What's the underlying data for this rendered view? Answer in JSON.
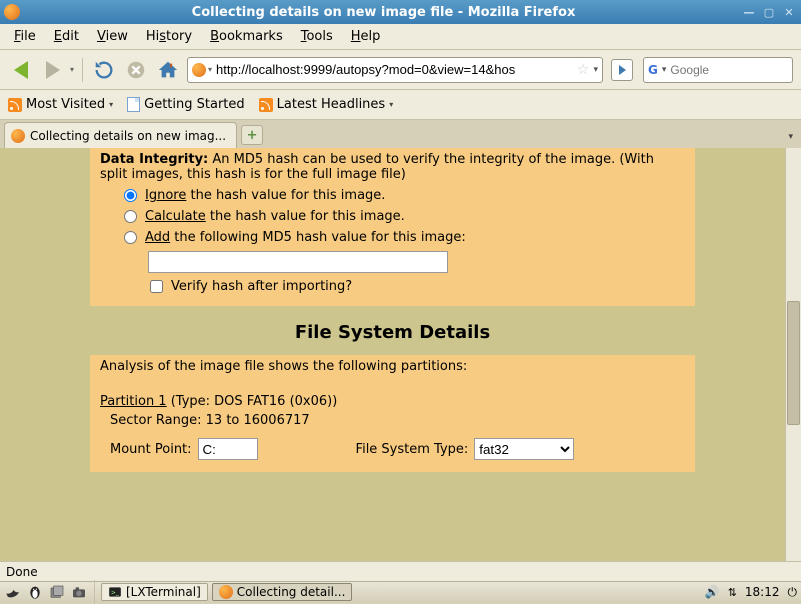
{
  "window": {
    "title": "Collecting details on new image file - Mozilla Firefox"
  },
  "menubar": {
    "file": "File",
    "edit": "Edit",
    "view": "View",
    "history": "History",
    "bookmarks": "Bookmarks",
    "tools": "Tools",
    "help": "Help"
  },
  "navbar": {
    "url": "http://localhost:9999/autopsy?mod=0&view=14&hos",
    "search_placeholder": "Google"
  },
  "bookmarks": {
    "most_visited": "Most Visited",
    "getting_started": "Getting Started",
    "latest_headlines": "Latest Headlines"
  },
  "tab": {
    "label": "Collecting details on new imag..."
  },
  "content": {
    "di_label": "Data Integrity:",
    "di_text": " An MD5 hash can be used to verify the integrity of the image. (With split images, this hash is for the full image file)",
    "opt_ignore_u": "Ignore",
    "opt_ignore_t": " the hash value for this image.",
    "opt_calc_u": "Calculate",
    "opt_calc_t": " the hash value for this image.",
    "opt_add_u": "Add",
    "opt_add_t": " the following MD5 hash value for this image:",
    "md5_value": "",
    "verify_label": "Verify hash after importing?",
    "fs_heading": "File System Details",
    "analysis_text": "Analysis of the image file shows the following partitions:",
    "part1_label": "Partition 1",
    "part1_type": " (Type: DOS FAT16 (0x06))",
    "sector_range": "Sector Range: 13 to 16006717",
    "mount_label": "Mount Point: ",
    "mount_value": "C:",
    "fstype_label": "File System Type: ",
    "fstype_value": "fat32"
  },
  "status": {
    "text": "Done"
  },
  "taskbar": {
    "term": "[LXTerminal]",
    "ff": "Collecting detail...",
    "clock": "18:12"
  }
}
